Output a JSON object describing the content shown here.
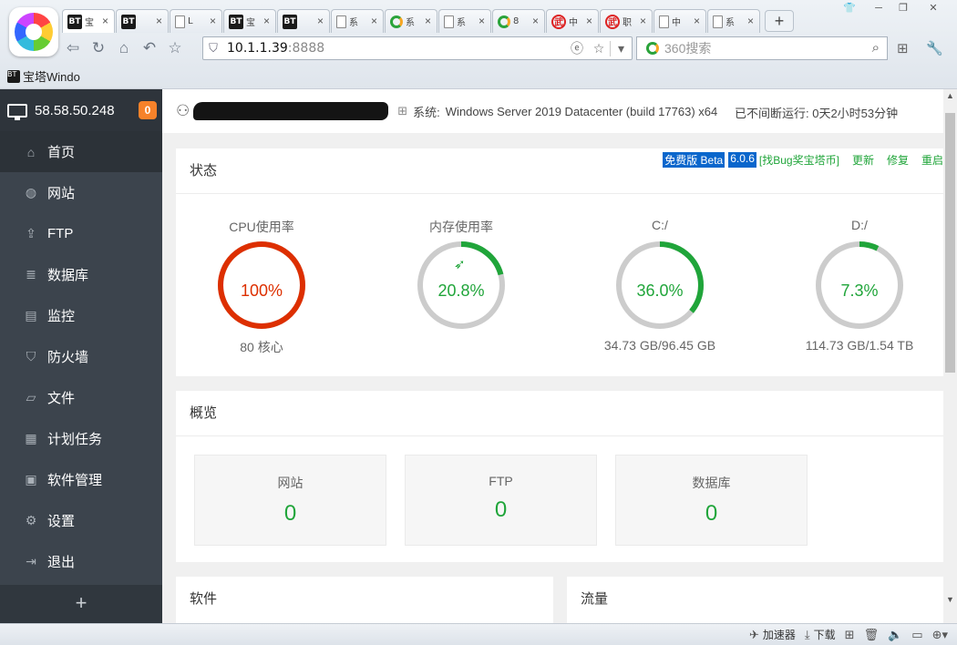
{
  "browser": {
    "tabs": [
      {
        "icon": "bt",
        "title": "宝",
        "active": true
      },
      {
        "icon": "bt",
        "title": ""
      },
      {
        "icon": "doc",
        "title": "L"
      },
      {
        "icon": "bt",
        "title": "宝"
      },
      {
        "icon": "bt",
        "title": ""
      },
      {
        "icon": "doc",
        "title": "系"
      },
      {
        "icon": "circ",
        "title": "系"
      },
      {
        "icon": "doc",
        "title": "系"
      },
      {
        "icon": "circ",
        "title": "8"
      },
      {
        "icon": "seal",
        "title": "中"
      },
      {
        "icon": "seal",
        "title": "职"
      },
      {
        "icon": "doc",
        "title": "中"
      },
      {
        "icon": "doc",
        "title": "系"
      }
    ],
    "new_tab": "+",
    "url_host": "10.1.1.39",
    "url_port": ":8888",
    "search_placeholder": "360搜索",
    "bookmark": "宝塔Windo",
    "bookmark_icon": "BT"
  },
  "sidebar": {
    "ip": "58.58.50.248",
    "badge": "0",
    "items": [
      {
        "icon": "home-icon",
        "glyph": "⌂",
        "label": "首页"
      },
      {
        "icon": "globe-icon",
        "glyph": "◍",
        "label": "网站"
      },
      {
        "icon": "ftp-icon",
        "glyph": "⇪",
        "label": "FTP"
      },
      {
        "icon": "database-icon",
        "glyph": "≣",
        "label": "数据库"
      },
      {
        "icon": "monitor-icon",
        "glyph": "▤",
        "label": "监控"
      },
      {
        "icon": "shield-icon",
        "glyph": "⛉",
        "label": "防火墙"
      },
      {
        "icon": "folder-icon",
        "glyph": "▱",
        "label": "文件"
      },
      {
        "icon": "calendar-icon",
        "glyph": "▦",
        "label": "计划任务"
      },
      {
        "icon": "apps-icon",
        "glyph": "▣",
        "label": "软件管理"
      },
      {
        "icon": "gear-icon",
        "glyph": "⚙",
        "label": "设置"
      },
      {
        "icon": "logout-icon",
        "glyph": "⇥",
        "label": "退出"
      }
    ],
    "add": "+"
  },
  "top": {
    "os_label": "系统:",
    "os": "Windows Server 2019 Datacenter (build 17763) x64",
    "uptime": "已不间断运行: 0天2小时53分钟"
  },
  "status": {
    "title": "状态",
    "version_tag": "免费版 Beta",
    "version": "6.0.6",
    "bug_link": "[找Bug奖宝塔币]",
    "update": "更新",
    "repair": "修复",
    "restart": "重启",
    "gauges": [
      {
        "label": "CPU使用率",
        "value": "100%",
        "percent": 100,
        "sub": "80 核心",
        "color": "#dd2f00"
      },
      {
        "label": "内存使用率",
        "value": "20.8%",
        "percent": 20.8,
        "sub": "",
        "color": "#20a53a"
      },
      {
        "label": "C:/",
        "value": "36.0%",
        "percent": 36.0,
        "sub": "34.73 GB/96.45 GB",
        "color": "#20a53a"
      },
      {
        "label": "D:/",
        "value": "7.3%",
        "percent": 7.3,
        "sub": "114.73 GB/1.54 TB",
        "color": "#20a53a"
      }
    ]
  },
  "overview": {
    "title": "概览",
    "boxes": [
      {
        "label": "网站",
        "value": "0"
      },
      {
        "label": "FTP",
        "value": "0"
      },
      {
        "label": "数据库",
        "value": "0"
      }
    ]
  },
  "software": {
    "title": "软件"
  },
  "traffic": {
    "title": "流量"
  },
  "statusbar": {
    "accelerator": "加速器",
    "download": "下载"
  },
  "colors": {
    "accent": "#20a53a",
    "danger": "#dd2f00",
    "sidebar": "#3c444d"
  }
}
